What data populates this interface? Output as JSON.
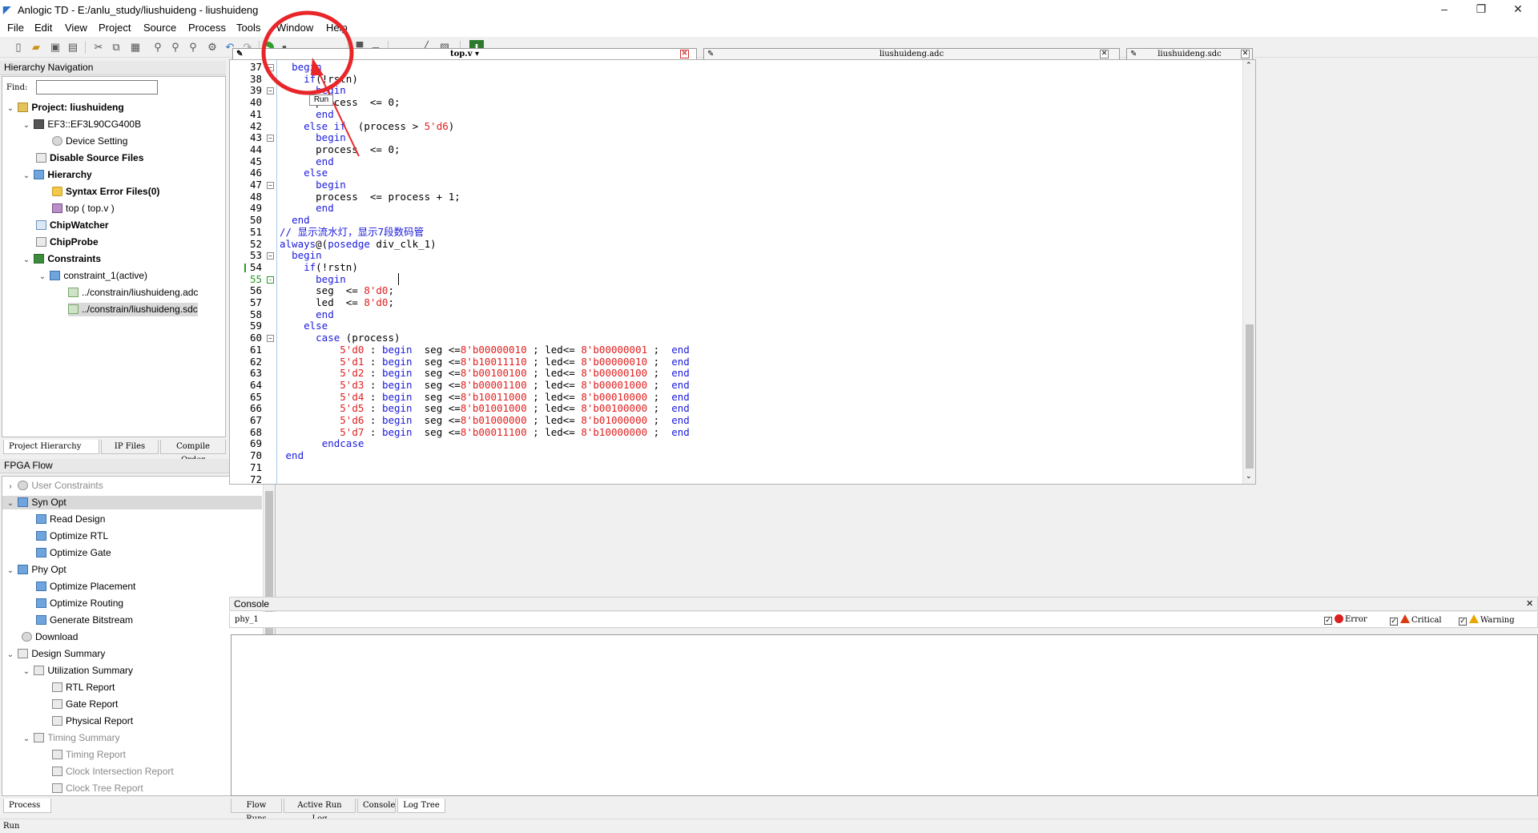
{
  "window": {
    "title": "Anlogic TD - E:/anlu_study/liushuideng - liushuideng",
    "minimize": "–",
    "maximize": "❐",
    "close": "✕"
  },
  "menu": [
    "File",
    "Edit",
    "View",
    "Project",
    "Source",
    "Process",
    "Tools",
    "Window",
    "Help"
  ],
  "toolbar": {
    "tooltip_run": "Run"
  },
  "hierarchy": {
    "title": "Hierarchy Navigation",
    "find_label": "Find:",
    "find_value": "",
    "items": [
      {
        "label": "Project: liushuideng"
      },
      {
        "label": "EF3::EF3L90CG400B"
      },
      {
        "label": "Device Setting"
      },
      {
        "label": "Disable Source Files"
      },
      {
        "label": "Hierarchy"
      },
      {
        "label": "Syntax Error Files(0)"
      },
      {
        "label": "top ( top.v )"
      },
      {
        "label": "ChipWatcher"
      },
      {
        "label": "ChipProbe"
      },
      {
        "label": "Constraints"
      },
      {
        "label": "constraint_1(active)"
      },
      {
        "label": "../constrain/liushuideng.adc"
      },
      {
        "label": "../constrain/liushuideng.sdc"
      }
    ],
    "tabs": [
      "Project Hierarchy",
      "IP Files",
      "Compile Order"
    ]
  },
  "flow": {
    "title": "FPGA Flow",
    "close": "✕",
    "items": [
      {
        "label": "User Constraints"
      },
      {
        "label": "Syn Opt"
      },
      {
        "label": "Read Design"
      },
      {
        "label": "Optimize RTL"
      },
      {
        "label": "Optimize Gate"
      },
      {
        "label": "Phy Opt"
      },
      {
        "label": "Optimize Placement"
      },
      {
        "label": "Optimize Routing"
      },
      {
        "label": "Generate Bitstream"
      },
      {
        "label": "Download"
      },
      {
        "label": "Design Summary"
      },
      {
        "label": "Utilization Summary"
      },
      {
        "label": "RTL Report"
      },
      {
        "label": "Gate Report"
      },
      {
        "label": "Physical Report"
      },
      {
        "label": "Timing Summary"
      },
      {
        "label": "Timing Report"
      },
      {
        "label": "Clock Intersection Report"
      },
      {
        "label": "Clock Tree Report"
      }
    ],
    "tab": "Process"
  },
  "editor": {
    "tabs": [
      {
        "label": "top.v",
        "close": "✕"
      },
      {
        "label": "liushuideng.adc",
        "close": "✕"
      },
      {
        "label": "liushuideng.sdc",
        "close": "✕"
      }
    ],
    "line_numbers": [
      "37",
      "38",
      "39",
      "40",
      "41",
      "42",
      "43",
      "44",
      "45",
      "46",
      "47",
      "48",
      "49",
      "50",
      "51",
      "52",
      "53",
      "54",
      "55",
      "56",
      "57",
      "58",
      "59",
      "60",
      "61",
      "62",
      "63",
      "64",
      "65",
      "66",
      "67",
      "68",
      "69",
      "70",
      "71",
      "72"
    ],
    "lines": [
      "  begin",
      "    if(!rstn)",
      "      begin",
      "      process  <= 0;",
      "      end",
      "    else if  (process > 5'd6)",
      "      begin",
      "      process  <= 0;",
      "      end",
      "    else",
      "      begin",
      "      process  <= process + 1;",
      "      end",
      "  end",
      "// 显示流水灯，显示7段数码管",
      "always@(posedge div_clk_1)",
      "  begin",
      "    if(!rstn)",
      "      begin",
      "      seg  <= 8'd0;",
      "      led  <= 8'd0;",
      "      end",
      "    else",
      "      case (process)",
      "          5'd0 : begin  seg <=8'b00000010 ; led<= 8'b00000001 ;  end",
      "          5'd1 : begin  seg <=8'b10011110 ; led<= 8'b00000010 ;  end",
      "          5'd2 : begin  seg <=8'b00100100 ; led<= 8'b00000100 ;  end",
      "          5'd3 : begin  seg <=8'b00001100 ; led<= 8'b00001000 ;  end",
      "          5'd4 : begin  seg <=8'b10011000 ; led<= 8'b00010000 ;  end",
      "          5'd5 : begin  seg <=8'b01001000 ; led<= 8'b00100000 ;  end",
      "          5'd6 : begin  seg <=8'b01000000 ; led<= 8'b01000000 ;  end",
      "          5'd7 : begin  seg <=8'b00011100 ; led<= 8'b10000000 ;  end",
      "       endcase",
      " end",
      "",
      ""
    ]
  },
  "console": {
    "title": "Console",
    "close": "✕",
    "run_name": "phy_1",
    "filters": {
      "error": "Error",
      "critical": "Critical",
      "warning": "Warning"
    },
    "tabs": [
      "Flow Runs",
      "Active Run Log",
      "Console",
      "Log Tree"
    ]
  },
  "status": {
    "text": "Run"
  },
  "colors": {
    "keyword": "#1a1adb",
    "number": "#e02020",
    "annotation": "#e8262a"
  }
}
